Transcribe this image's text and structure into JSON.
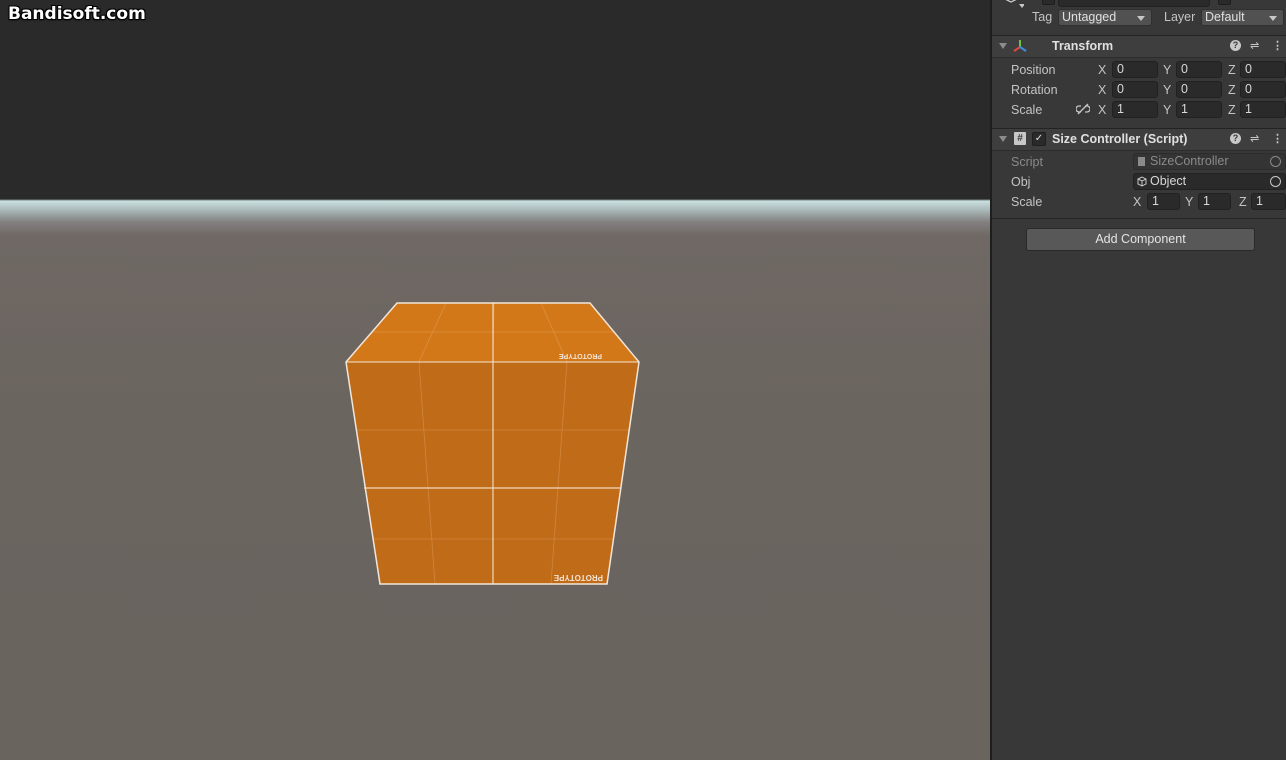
{
  "watermark": "Bandisoft.com",
  "inspector": {
    "tag_label": "Tag",
    "tag_value": "Untagged",
    "layer_label": "Layer",
    "layer_value": "Default",
    "transform": {
      "title": "Transform",
      "rows": [
        {
          "label": "Position",
          "x": "0",
          "y": "0",
          "z": "0"
        },
        {
          "label": "Rotation",
          "x": "0",
          "y": "0",
          "z": "0"
        },
        {
          "label": "Scale",
          "x": "1",
          "y": "1",
          "z": "1"
        }
      ]
    },
    "size_controller": {
      "title": "Size Controller (Script)",
      "enabled": true,
      "script_label": "Script",
      "script_value": "SizeController",
      "obj_label": "Obj",
      "obj_value": "Object",
      "scale_label": "Scale",
      "scale_x": "1",
      "scale_y": "1",
      "scale_z": "1"
    },
    "add_component": "Add Component"
  },
  "axis_labels": {
    "x": "X",
    "y": "Y",
    "z": "Z"
  },
  "scene": {
    "cube_label": "PROTOTYPE",
    "cube_color": "#c8711a",
    "sky_color": "#2a2a2a",
    "ground_color": "#6a645f"
  }
}
